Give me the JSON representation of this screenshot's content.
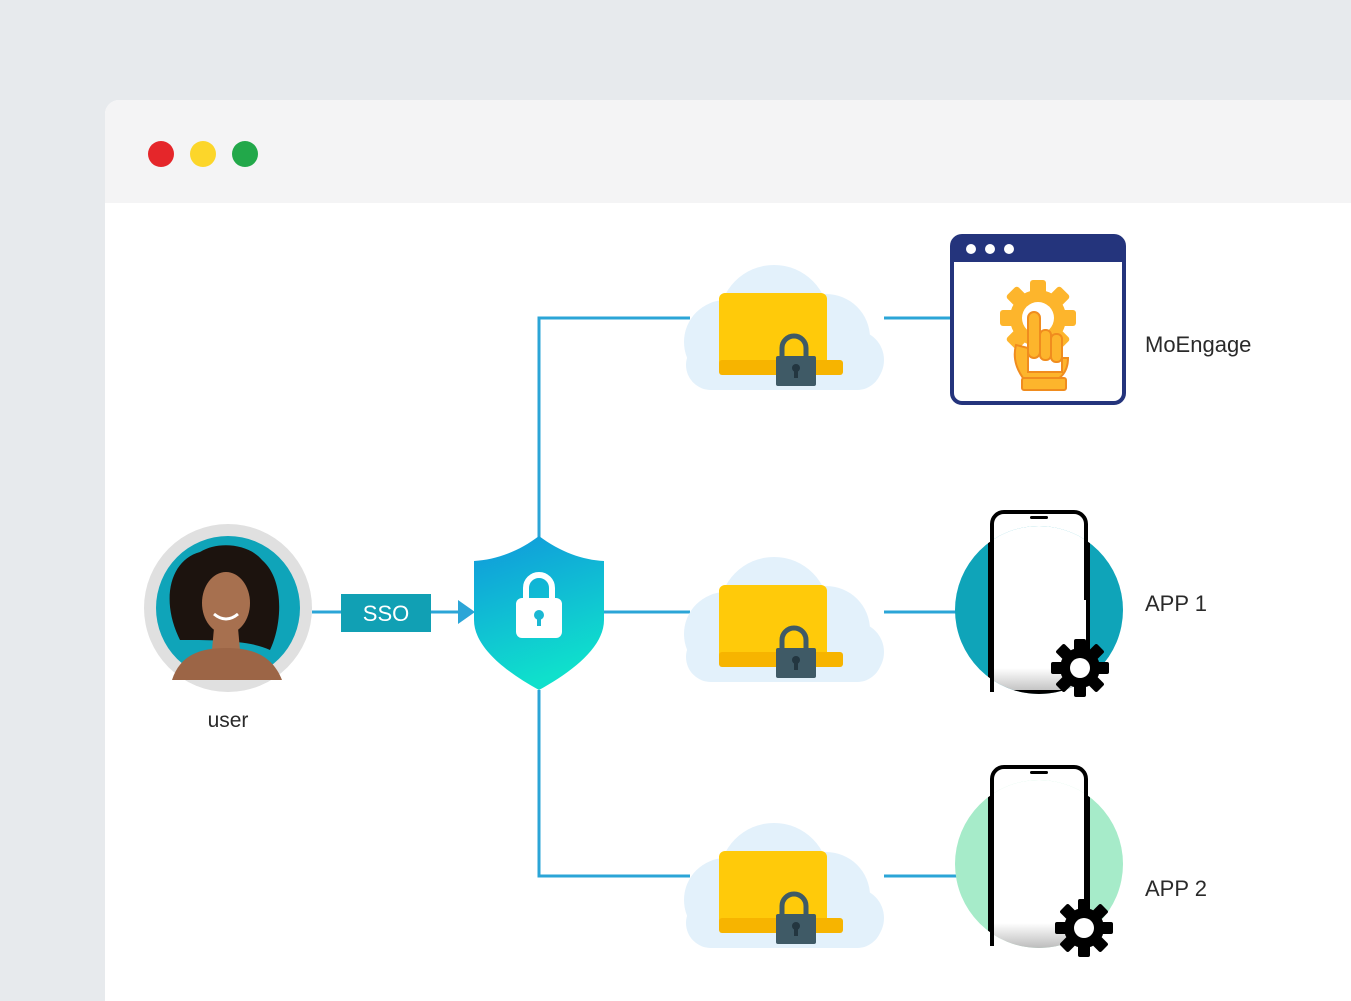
{
  "window": {
    "controls": [
      {
        "name": "close",
        "color": "#e5262a"
      },
      {
        "name": "minimize",
        "color": "#fcd62a"
      },
      {
        "name": "maximize",
        "color": "#22a84a"
      }
    ]
  },
  "diagram": {
    "user_label": "user",
    "sso_label": "SSO",
    "targets": [
      {
        "label": "MoEngage",
        "icon": "browser-gear-hand-icon"
      },
      {
        "label": "APP 1",
        "icon": "smartphone-gear-icon"
      },
      {
        "label": "APP 2",
        "icon": "smartphone-gear-icon"
      }
    ],
    "colors": {
      "connector": "#2ba5d7",
      "sso_badge": "#11a0b4",
      "folder": "#ffca0a",
      "cloud": "#e2f1fb",
      "lock": "#3f5a66",
      "app1_circle": "#0fa4b9",
      "app2_circle": "#a6ebc9",
      "browser_frame": "#24347c"
    }
  }
}
